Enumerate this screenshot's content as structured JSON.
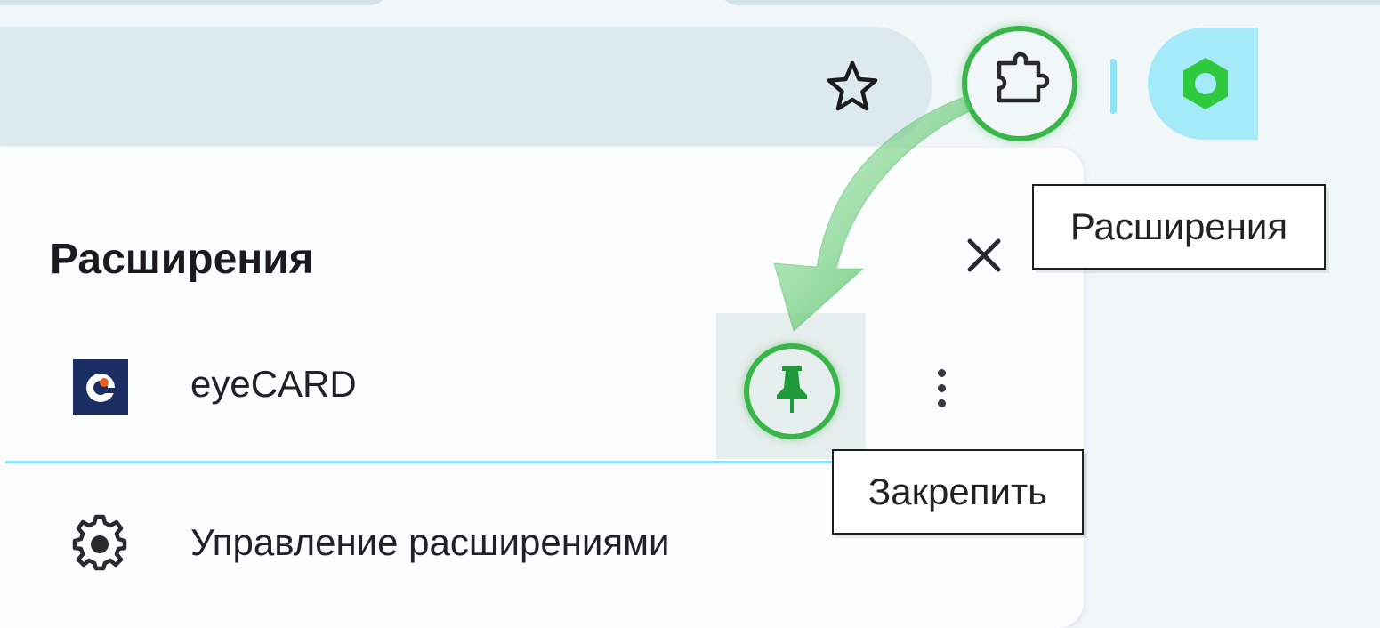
{
  "toolbar": {
    "bookmark_icon": "star-icon",
    "extensions_icon": "puzzle-icon",
    "profile_icon": "hexagon-icon"
  },
  "extensions_panel": {
    "title": "Расширения",
    "close_icon": "close-icon",
    "extensions": [
      {
        "name": "eyeCARD",
        "logo_icon": "eyecard-logo-icon",
        "pin_icon": "pin-icon",
        "more_icon": "more-vert-icon"
      }
    ],
    "manage": {
      "label": "Управление расширениями",
      "icon": "gear-icon"
    }
  },
  "tooltips": {
    "extensions_button": "Расширения",
    "pin": "Закрепить"
  },
  "colors": {
    "highlight_green": "#39b54a",
    "accent_cyan": "#8fe3f2",
    "profile_bg": "#a4eaf8",
    "eyecard_logo_bg": "#1b2e63",
    "eyecard_logo_accent": "#e8601c"
  }
}
